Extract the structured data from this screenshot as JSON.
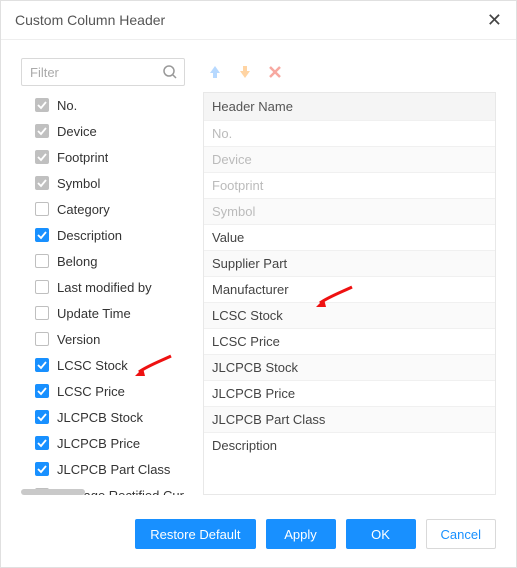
{
  "dialog": {
    "title": "Custom Column Header"
  },
  "search": {
    "placeholder": "Filter"
  },
  "columns": [
    {
      "label": "No.",
      "checked": true,
      "locked": true
    },
    {
      "label": "Device",
      "checked": true,
      "locked": true
    },
    {
      "label": "Footprint",
      "checked": true,
      "locked": true
    },
    {
      "label": "Symbol",
      "checked": true,
      "locked": true
    },
    {
      "label": "Category",
      "checked": false,
      "locked": false
    },
    {
      "label": "Description",
      "checked": true,
      "locked": false
    },
    {
      "label": "Belong",
      "checked": false,
      "locked": false
    },
    {
      "label": "Last modified by",
      "checked": false,
      "locked": false
    },
    {
      "label": "Update Time",
      "checked": false,
      "locked": false
    },
    {
      "label": "Version",
      "checked": false,
      "locked": false
    },
    {
      "label": "LCSC Stock",
      "checked": true,
      "locked": false
    },
    {
      "label": "LCSC Price",
      "checked": true,
      "locked": false
    },
    {
      "label": "JLCPCB Stock",
      "checked": true,
      "locked": false
    },
    {
      "label": "JLCPCB Price",
      "checked": true,
      "locked": false
    },
    {
      "label": "JLCPCB Part Class",
      "checked": true,
      "locked": false
    },
    {
      "label": "Average Rectified Cur",
      "checked": false,
      "locked": false
    }
  ],
  "header_table": {
    "header": "Header Name",
    "rows": [
      {
        "label": "No.",
        "locked": true
      },
      {
        "label": "Device",
        "locked": true
      },
      {
        "label": "Footprint",
        "locked": true
      },
      {
        "label": "Symbol",
        "locked": true
      },
      {
        "label": "Value",
        "locked": false
      },
      {
        "label": "Supplier Part",
        "locked": false
      },
      {
        "label": "Manufacturer",
        "locked": false
      },
      {
        "label": "LCSC Stock",
        "locked": false
      },
      {
        "label": "LCSC Price",
        "locked": false
      },
      {
        "label": "JLCPCB Stock",
        "locked": false
      },
      {
        "label": "JLCPCB Price",
        "locked": false
      },
      {
        "label": "JLCPCB Part Class",
        "locked": false
      },
      {
        "label": "Description",
        "locked": false
      }
    ]
  },
  "toolbar": {
    "up_color": "#b7d9ff",
    "down_color": "#ffd4a3",
    "remove_color": "#f7a8a0"
  },
  "buttons": {
    "restore": "Restore Default",
    "apply": "Apply",
    "ok": "OK",
    "cancel": "Cancel"
  },
  "arrow_color": "#e11"
}
